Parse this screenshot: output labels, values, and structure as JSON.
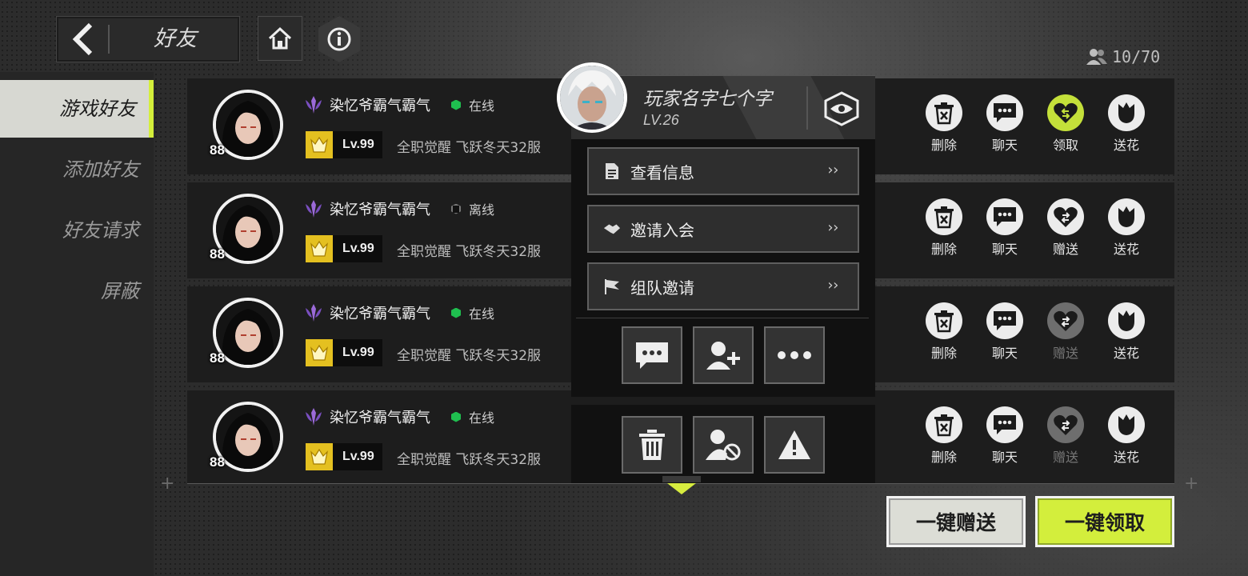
{
  "header": {
    "title": "好友",
    "friend_count": "10/70"
  },
  "sidebar": {
    "tabs": [
      {
        "label": "游戏好友",
        "active": true
      },
      {
        "label": "添加好友",
        "active": false
      },
      {
        "label": "好友请求",
        "active": false
      },
      {
        "label": "屏蔽",
        "active": false
      }
    ]
  },
  "friends": [
    {
      "name": "染忆爷霸气霸气",
      "status": "在线",
      "status_color": "#1fbf4f",
      "level_badge": "88",
      "level": "Lv.99",
      "server": "全职觉醒 飞跃冬天32服",
      "actions": [
        {
          "label": "删除",
          "icon": "trash-icon",
          "state": "normal"
        },
        {
          "label": "聊天",
          "icon": "chat-icon",
          "state": "normal"
        },
        {
          "label": "领取",
          "icon": "heart-receive-icon",
          "state": "highlight"
        },
        {
          "label": "送花",
          "icon": "tulip-icon",
          "state": "normal"
        }
      ]
    },
    {
      "name": "染忆爷霸气霸气",
      "status": "离线",
      "status_color": "#111111",
      "level_badge": "88",
      "level": "Lv.99",
      "server": "全职觉醒 飞跃冬天32服",
      "actions": [
        {
          "label": "删除",
          "icon": "trash-icon",
          "state": "normal"
        },
        {
          "label": "聊天",
          "icon": "chat-icon",
          "state": "normal"
        },
        {
          "label": "赠送",
          "icon": "heart-send-icon",
          "state": "normal"
        },
        {
          "label": "送花",
          "icon": "tulip-icon",
          "state": "normal"
        }
      ]
    },
    {
      "name": "染忆爷霸气霸气",
      "status": "在线",
      "status_color": "#1fbf4f",
      "level_badge": "88",
      "level": "Lv.99",
      "server": "全职觉醒 飞跃冬天32服",
      "actions": [
        {
          "label": "删除",
          "icon": "trash-icon",
          "state": "normal"
        },
        {
          "label": "聊天",
          "icon": "chat-icon",
          "state": "normal"
        },
        {
          "label": "赠送",
          "icon": "heart-send-icon",
          "state": "disabled"
        },
        {
          "label": "送花",
          "icon": "tulip-icon",
          "state": "normal"
        }
      ]
    },
    {
      "name": "染忆爷霸气霸气",
      "status": "在线",
      "status_color": "#1fbf4f",
      "level_badge": "88",
      "level": "Lv.99",
      "server": "全职觉醒 飞跃冬天32服",
      "actions": [
        {
          "label": "删除",
          "icon": "trash-icon",
          "state": "normal"
        },
        {
          "label": "聊天",
          "icon": "chat-icon",
          "state": "normal"
        },
        {
          "label": "赠送",
          "icon": "heart-send-icon",
          "state": "disabled"
        },
        {
          "label": "送花",
          "icon": "tulip-icon",
          "state": "normal"
        }
      ]
    }
  ],
  "popup": {
    "player_name": "玩家名字七个字",
    "player_level": "LV.26",
    "menu": [
      {
        "label": "查看信息",
        "icon": "document-icon"
      },
      {
        "label": "邀请入会",
        "icon": "handshake-icon"
      },
      {
        "label": "组队邀请",
        "icon": "flag-icon"
      }
    ]
  },
  "footer": {
    "gift_all": "一键赠送",
    "claim_all": "一键领取"
  },
  "colors": {
    "accent": "#d4ef3b",
    "online": "#1fbf4f",
    "purple_badge": "#9b6ad8"
  }
}
